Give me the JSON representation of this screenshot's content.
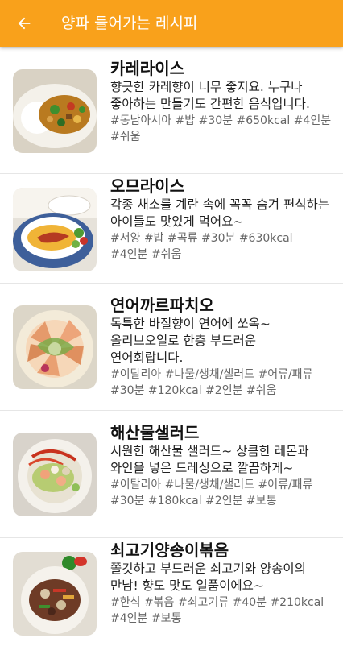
{
  "appbar": {
    "title": "양파 들어가는 레시피",
    "back_icon": "arrow-left-icon"
  },
  "recipes": [
    {
      "title": "카레라이스",
      "description": "향긋한 카레향이 너무 좋지요. 누구나 좋아하는 만들기도 간편한 음식입니다.",
      "tags": "#동남아시아 #밥 #30분 #650kcal #4인분 #쉬움",
      "image": "curry-rice-photo"
    },
    {
      "title": "오므라이스",
      "description": "각종 채소를 계란 속에 꼭꼭 숨겨 편식하는 아이들도 맛있게 먹어요~",
      "tags": "#서양 #밥 #곡류 #30분 #630kcal #4인분 #쉬움",
      "image": "omelette-rice-photo"
    },
    {
      "title": "연어까르파치오",
      "description": "독특한 바질향이 연어에 쏘옥~ 올리브오일로 한층 부드러운 연어회랍니다.",
      "tags": "#이탈리아 #나물/생채/샐러드 #어류/패류 #30분 #120kcal #2인분 #쉬움",
      "image": "salmon-carpaccio-photo"
    },
    {
      "title": "해산물샐러드",
      "description": "시원한 해산물 샐러드~ 상큼한 레몬과 와인을 넣은 드레싱으로 깔끔하게~",
      "tags": "#이탈리아 #나물/생채/샐러드 #어류/패류 #30분 #180kcal #2인분 #보통",
      "image": "seafood-salad-photo"
    },
    {
      "title": "쇠고기양송이볶음",
      "description": "쫄깃하고 부드러운 쇠고기와 양송이의 만남! 향도 맛도 일품이에요~",
      "tags": "#한식 #볶음 #쇠고기류 #40분 #210kcal #4인분 #보통",
      "image": "beef-mushroom-stirfry-photo"
    }
  ],
  "colors": {
    "appbar": "#f9a11b",
    "title_text": "#111111",
    "tag_text": "#666666",
    "divider": "#e6e6e6"
  }
}
